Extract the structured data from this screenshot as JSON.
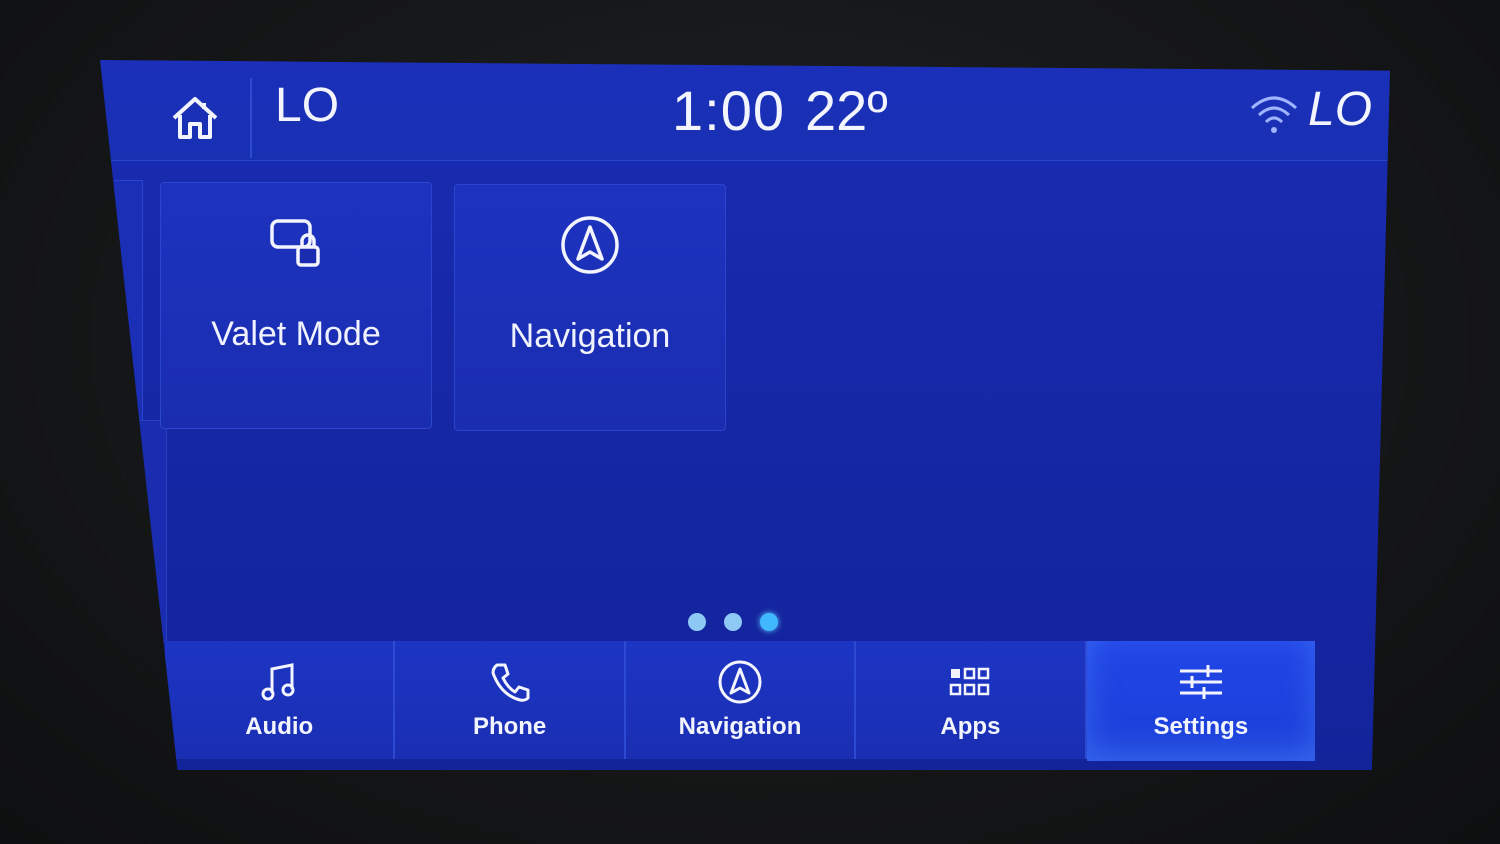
{
  "status_bar": {
    "left_value": "LO",
    "time": "1:00",
    "temperature": "22º",
    "right_value": "LO"
  },
  "tiles": [
    {
      "label": "Valet Mode",
      "icon": "valet-lock-icon"
    },
    {
      "label": "Navigation",
      "icon": "navigation-arrow-icon"
    }
  ],
  "pager": {
    "pages": 3,
    "active_index": 2
  },
  "nav_bar": {
    "items": [
      {
        "label": "Audio",
        "icon": "music-note-icon"
      },
      {
        "label": "Phone",
        "icon": "phone-icon"
      },
      {
        "label": "Navigation",
        "icon": "navigation-arrow-icon"
      },
      {
        "label": "Apps",
        "icon": "apps-grid-icon"
      },
      {
        "label": "Settings",
        "icon": "settings-sliders-icon"
      }
    ],
    "selected_index": 4
  },
  "colors": {
    "screen_blue": "#1628a8",
    "selected_blue": "#1b3fd8",
    "text": "#f2f4ff",
    "pager_active": "#3fb8ff"
  }
}
